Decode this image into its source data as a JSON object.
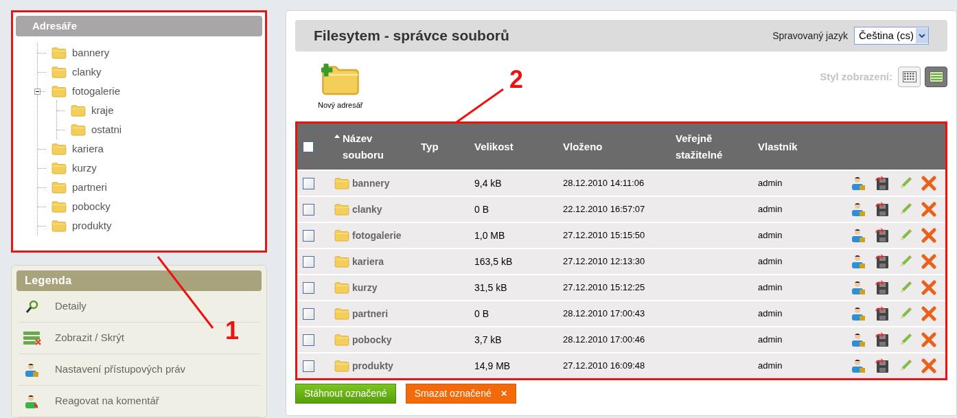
{
  "sidebar": {
    "tree": {
      "title": "Adresáře",
      "items": [
        {
          "name": "bannery"
        },
        {
          "name": "clanky"
        },
        {
          "name": "fotogalerie",
          "expanded": true,
          "children": [
            {
              "name": "kraje"
            },
            {
              "name": "ostatni"
            }
          ]
        },
        {
          "name": "kariera"
        },
        {
          "name": "kurzy"
        },
        {
          "name": "partneri"
        },
        {
          "name": "pobocky"
        },
        {
          "name": "produkty"
        }
      ]
    },
    "legend": {
      "title": "Legenda",
      "items": [
        {
          "kind": "details",
          "label": "Detaily"
        },
        {
          "kind": "toggle",
          "label": "Zobrazit / Skrýt"
        },
        {
          "kind": "access",
          "label": "Nastavení přístupových práv"
        },
        {
          "kind": "comment",
          "label": "Reagovat na komentář"
        }
      ]
    }
  },
  "main": {
    "title": "Filesytem - správce souborů",
    "language": {
      "label": "Spravovaný jazyk",
      "value": "Čeština (cs)"
    },
    "new_folder": "Nový adresář",
    "view_style": {
      "label": "Styl zobrazení:",
      "options": [
        {
          "kind": "grid",
          "selected": false
        },
        {
          "kind": "list",
          "selected": true
        }
      ]
    },
    "table": {
      "select_all": false,
      "columns": [
        {
          "label": "Název souboru",
          "sorted": true
        },
        {
          "label": "Typ",
          "sorted": false
        },
        {
          "label": "Velikost",
          "sorted": false
        },
        {
          "label": "Vloženo",
          "sorted": false
        },
        {
          "label": "Veřejně stažitelné",
          "sorted": false
        },
        {
          "label": "Vlastník",
          "sorted": false
        }
      ],
      "rows": [
        {
          "checked": false,
          "name": "bannery",
          "size": "9,4 kB",
          "inserted": "28.12.2010 14:11:06",
          "owner": "admin"
        },
        {
          "checked": false,
          "name": "clanky",
          "size": "0 B",
          "inserted": "22.12.2010 16:57:07",
          "owner": "admin"
        },
        {
          "checked": false,
          "name": "fotogalerie",
          "size": "1,0 MB",
          "inserted": "27.12.2010 15:15:50",
          "owner": "admin"
        },
        {
          "checked": false,
          "name": "kariera",
          "size": "163,5 kB",
          "inserted": "27.12.2010 12:13:30",
          "owner": "admin"
        },
        {
          "checked": false,
          "name": "kurzy",
          "size": "31,5 kB",
          "inserted": "27.12.2010 15:12:25",
          "owner": "admin"
        },
        {
          "checked": false,
          "name": "partneri",
          "size": "0 B",
          "inserted": "28.12.2010 17:00:43",
          "owner": "admin"
        },
        {
          "checked": false,
          "name": "pobocky",
          "size": "3,7 kB",
          "inserted": "28.12.2010 17:00:46",
          "owner": "admin"
        },
        {
          "checked": false,
          "name": "produkty",
          "size": "14,9 MB",
          "inserted": "27.12.2010 16:09:48",
          "owner": "admin"
        }
      ]
    },
    "buttons": [
      {
        "kind": "download",
        "label": "Stáhnout označené"
      },
      {
        "kind": "delete",
        "label": "Smazat označené",
        "icon": "×"
      }
    ]
  },
  "annotations": [
    {
      "label": "1"
    },
    {
      "label": "2"
    }
  ]
}
